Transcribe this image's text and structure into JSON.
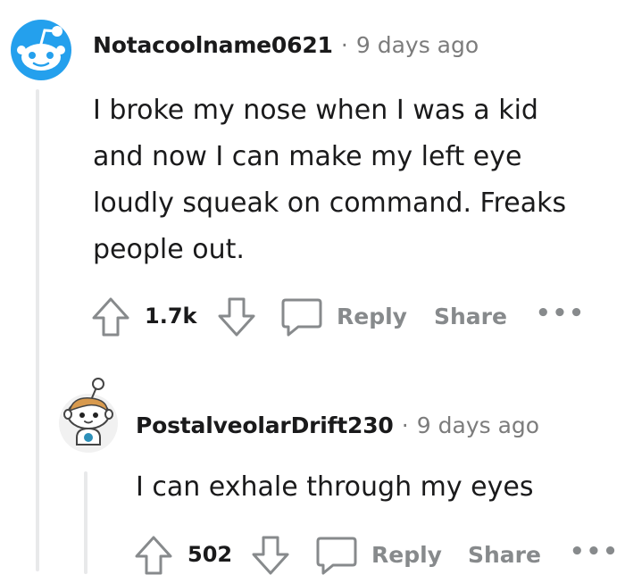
{
  "comment1": {
    "username": "Notacoolname0621",
    "separator": "·",
    "time": "9 days ago",
    "lines": [
      "I broke my nose when I was a kid",
      "and now I can make my left eye",
      "loudly squeak on command. Freaks",
      "people out."
    ],
    "score": "1.7k",
    "reply_label": "Reply",
    "share_label": "Share",
    "more_label": "•••"
  },
  "comment2": {
    "username": "PostalveolarDrift230",
    "separator": "·",
    "time": "9 days ago",
    "text": "I can exhale through my eyes",
    "score": "502",
    "reply_label": "Reply",
    "share_label": "Share",
    "more_label": "•••"
  },
  "colors": {
    "avatar1_bg": "#24a0ed",
    "meta_gray": "#7c7c7c",
    "action_gray": "#878a8c"
  }
}
